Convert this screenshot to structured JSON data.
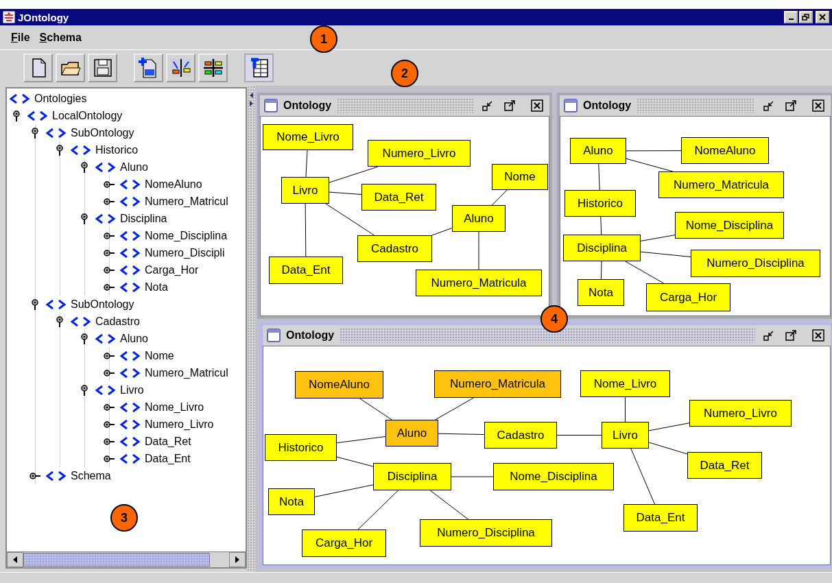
{
  "window": {
    "title": "JOntology"
  },
  "menu": [
    "File",
    "Schema"
  ],
  "toolbar": {
    "groups": [
      [
        {
          "kind": "new",
          "pressed": false
        },
        {
          "kind": "open",
          "pressed": false
        },
        {
          "kind": "save",
          "pressed": false
        }
      ],
      [
        {
          "kind": "dtd",
          "pressed": false
        },
        {
          "kind": "layout",
          "pressed": false
        },
        {
          "kind": "align",
          "pressed": false
        }
      ],
      [
        {
          "kind": "table",
          "pressed": true
        }
      ]
    ]
  },
  "tree": {
    "label": "Ontologies",
    "children": [
      {
        "label": "LocalOntology",
        "expanded": true,
        "children": [
          {
            "label": "SubOntology",
            "expanded": true,
            "children": [
              {
                "label": "Historico",
                "expanded": true,
                "children": [
                  {
                    "label": "Aluno",
                    "expanded": true,
                    "children": [
                      {
                        "label": "NomeAluno",
                        "expanded": false
                      },
                      {
                        "label": "Numero_Matricul",
                        "expanded": false
                      }
                    ]
                  },
                  {
                    "label": "Disciplina",
                    "expanded": true,
                    "children": [
                      {
                        "label": "Nome_Disciplina",
                        "expanded": false
                      },
                      {
                        "label": "Numero_Discipli",
                        "expanded": false
                      },
                      {
                        "label": "Carga_Hor",
                        "expanded": false
                      },
                      {
                        "label": "Nota",
                        "expanded": false
                      }
                    ]
                  }
                ]
              }
            ]
          },
          {
            "label": "SubOntology",
            "expanded": true,
            "children": [
              {
                "label": "Cadastro",
                "expanded": true,
                "children": [
                  {
                    "label": "Aluno",
                    "expanded": true,
                    "children": [
                      {
                        "label": "Nome",
                        "expanded": false
                      },
                      {
                        "label": "Numero_Matricul",
                        "expanded": false
                      }
                    ]
                  },
                  {
                    "label": "Livro",
                    "expanded": true,
                    "children": [
                      {
                        "label": "Nome_Livro",
                        "expanded": false
                      },
                      {
                        "label": "Numero_Livro",
                        "expanded": false
                      },
                      {
                        "label": "Data_Ret",
                        "expanded": false
                      },
                      {
                        "label": "Data_Ent",
                        "expanded": false
                      }
                    ]
                  }
                ]
              }
            ]
          },
          {
            "label": "Schema",
            "expanded": false
          }
        ]
      }
    ]
  },
  "frames": [
    {
      "title": "Ontology",
      "active": false,
      "nodes": [
        {
          "label": "Nome_Livro",
          "selected": false
        },
        {
          "label": "Numero_Livro",
          "selected": false
        },
        {
          "label": "Nome",
          "selected": false
        },
        {
          "label": "Livro",
          "selected": false
        },
        {
          "label": "Data_Ret",
          "selected": false
        },
        {
          "label": "Aluno",
          "selected": false
        },
        {
          "label": "Cadastro",
          "selected": false
        },
        {
          "label": "Data_Ent",
          "selected": false
        },
        {
          "label": "Numero_Matricula",
          "selected": false
        }
      ]
    },
    {
      "title": "Ontology",
      "active": false,
      "nodes": [
        {
          "label": "Aluno",
          "selected": false
        },
        {
          "label": "NomeAluno",
          "selected": false
        },
        {
          "label": "Numero_Matricula",
          "selected": false
        },
        {
          "label": "Historico",
          "selected": false
        },
        {
          "label": "Nome_Disciplina",
          "selected": false
        },
        {
          "label": "Disciplina",
          "selected": false
        },
        {
          "label": "Numero_Disciplina",
          "selected": false
        },
        {
          "label": "Nota",
          "selected": false
        },
        {
          "label": "Carga_Hor",
          "selected": false
        }
      ]
    },
    {
      "title": "Ontology",
      "active": true,
      "nodes": [
        {
          "label": "NomeAluno",
          "selected": true
        },
        {
          "label": "Numero_Matricula",
          "selected": true
        },
        {
          "label": "Nome_Livro",
          "selected": false
        },
        {
          "label": "Numero_Livro",
          "selected": false
        },
        {
          "label": "Aluno",
          "selected": true
        },
        {
          "label": "Cadastro",
          "selected": false
        },
        {
          "label": "Livro",
          "selected": false
        },
        {
          "label": "Historico",
          "selected": false
        },
        {
          "label": "Data_Ret",
          "selected": false
        },
        {
          "label": "Disciplina",
          "selected": false
        },
        {
          "label": "Nome_Disciplina",
          "selected": false
        },
        {
          "label": "Nota",
          "selected": false
        },
        {
          "label": "Data_Ent",
          "selected": false
        },
        {
          "label": "Numero_Disciplina",
          "selected": false
        },
        {
          "label": "Carga_Hor",
          "selected": false
        }
      ]
    }
  ],
  "callouts": [
    "1",
    "2",
    "3",
    "4"
  ]
}
